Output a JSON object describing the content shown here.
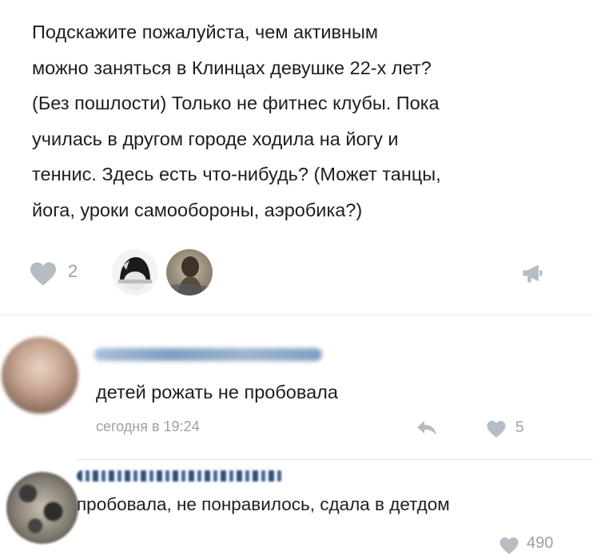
{
  "post": {
    "lines": [
      "Подскажите пожалуйста, чем активным",
      "можно заняться в Клинцах девушке 22-х лет?",
      "(Без пошлости) Только не фитнес клубы. Пока",
      "училась в другом городе ходила на йогу и",
      "теннис. Здесь есть что-нибудь? (Может танцы,",
      "йога, уроки самообороны, аэробика?)"
    ],
    "like_count": "2"
  },
  "comments": [
    {
      "text": "детей рожать не пробовала",
      "timestamp": "сегодня в 19:24",
      "like_count": "5"
    },
    {
      "text": "пробовала, не понравилось, сдала в детдом",
      "like_count": "490"
    }
  ],
  "colors": {
    "icon_gray": "#b6bcc3",
    "meta_text": "#9aa1a9",
    "divider": "#e4e6ea"
  },
  "icons": {
    "like": "heart-icon",
    "share": "megaphone-icon",
    "reply": "reply-arrow-icon"
  }
}
